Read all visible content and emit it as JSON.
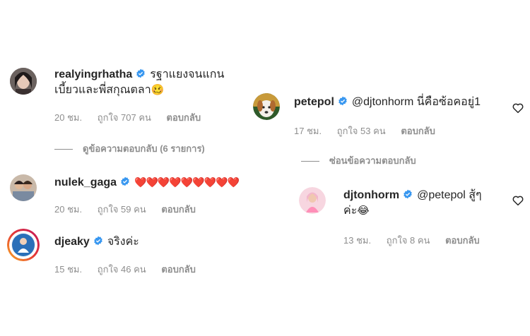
{
  "left": {
    "c1": {
      "username": "realyingrhatha",
      "text_line1": "รฐาแยงจนแกน",
      "text_line2": "เบี้ยวและพี่สกุณตลา",
      "emoji": "🥴",
      "time": "20 ชม.",
      "likes": "ถูกใจ 707 คน",
      "reply": "ตอบกลับ",
      "view_replies": "ดูข้อความตอบกลับ (6 รายการ)"
    },
    "c2": {
      "username": "nulek_gaga",
      "text": "❤️❤️❤️❤️❤️❤️❤️❤️❤️",
      "time": "20 ชม.",
      "likes": "ถูกใจ 59 คน",
      "reply": "ตอบกลับ"
    },
    "c3": {
      "username": "djeaky",
      "text": "จริงค่ะ",
      "time": "15 ชม.",
      "likes": "ถูกใจ 46 คน",
      "reply": "ตอบกลับ"
    }
  },
  "right": {
    "c1": {
      "username": "petepol",
      "mention": "@djtonhorm",
      "text": "นี่คือซ้อคอยู่1",
      "time": "17 ชม.",
      "likes": "ถูกใจ 53 คน",
      "reply": "ตอบกลับ",
      "hide_replies": "ซ่อนข้อความตอบกลับ"
    },
    "c2": {
      "username": "djtonhorm",
      "mention": "@petepol",
      "text": "สู้ๆ",
      "text_line2": "ค่ะ",
      "emoji": "😂",
      "time": "13 ชม.",
      "likes": "ถูกใจ 8 คน",
      "reply": "ตอบกลับ"
    }
  },
  "colors": {
    "verified": "#3897f0",
    "meta": "#8e8e8e",
    "heart_red": "#ed1c24"
  },
  "icons": [
    "verified-badge-icon",
    "heart-icon"
  ]
}
